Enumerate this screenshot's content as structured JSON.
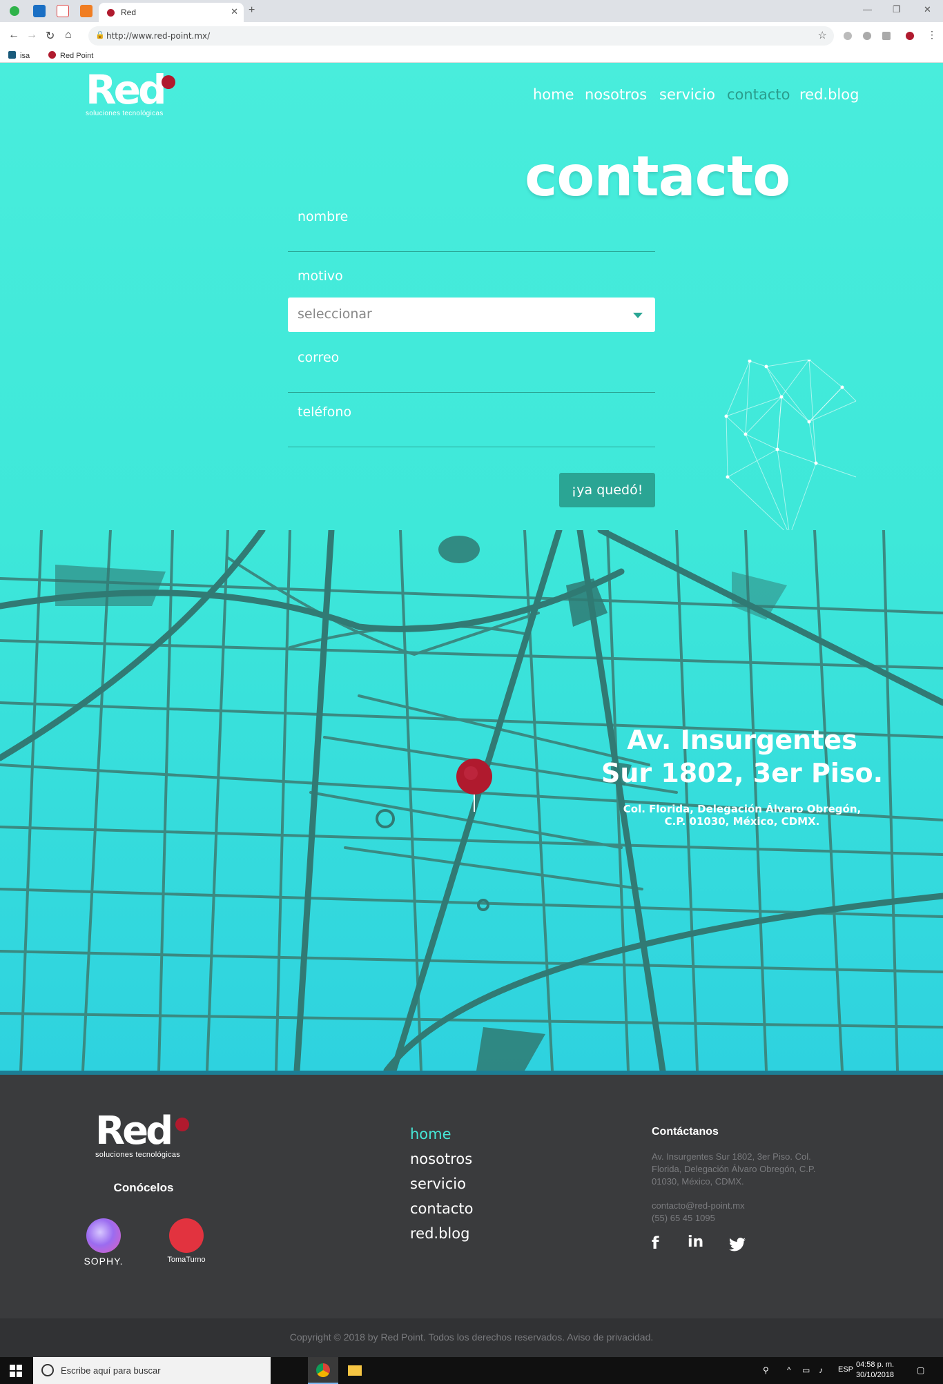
{
  "browser": {
    "tab_title": "Red",
    "url": "http://www.red-point.mx/",
    "bookmarks": [
      "isa",
      "Red Point"
    ]
  },
  "site": {
    "logo_word": "Red",
    "logo_tagline": "soluciones tecnológicas",
    "nav": [
      {
        "label": "home",
        "active": false
      },
      {
        "label": "nosotros",
        "active": false
      },
      {
        "label": "servicio",
        "active": false
      },
      {
        "label": "contacto",
        "active": true
      },
      {
        "label": "red.blog",
        "active": false
      }
    ],
    "title": "contacto"
  },
  "form": {
    "nombre_label": "nombre",
    "motivo_label": "motivo",
    "motivo_selected": "seleccionar",
    "correo_label": "correo",
    "telefono_label": "teléfono",
    "submit_label": "¡ya quedó!"
  },
  "map": {
    "address_line1": "Av. Insurgentes",
    "address_line2": "Sur 1802, 3er Piso.",
    "address_sub1": "Col. Florida, Delegación Álvaro Obregón,",
    "address_sub2": "C.P. 01030, México, CDMX."
  },
  "footer": {
    "conocelos": "Conócelos",
    "partners": [
      "SOPHY.",
      "TomaTurno"
    ],
    "links": [
      {
        "label": "home",
        "active": true
      },
      {
        "label": "nosotros",
        "active": false
      },
      {
        "label": "servicio",
        "active": false
      },
      {
        "label": "contacto",
        "active": false
      },
      {
        "label": "red.blog",
        "active": false
      }
    ],
    "contact_title": "Contáctanos",
    "contact_address": "Av. Insurgentes Sur 1802, 3er Piso. Col. Florida, Delegación Álvaro Obregón, C.P. 01030, México, CDMX.",
    "contact_email": "contacto@red-point.mx",
    "contact_phone": "(55) 65 45 1095",
    "social": [
      "facebook-icon",
      "linkedin-icon",
      "twitter-icon"
    ],
    "copyright": "Copyright © 2018 by Red Point. Todos los derechos reservados. Aviso de privacidad."
  },
  "taskbar": {
    "search_placeholder": "Escribe aquí para buscar",
    "language": "ESP",
    "time": "04:58 p. m.",
    "date": "30/10/2018"
  },
  "colors": {
    "brand_red": "#b01a2e",
    "accent_teal": "#2aa594",
    "hero_bg": "#49eddc",
    "footer_bg": "#3a3b3d"
  }
}
